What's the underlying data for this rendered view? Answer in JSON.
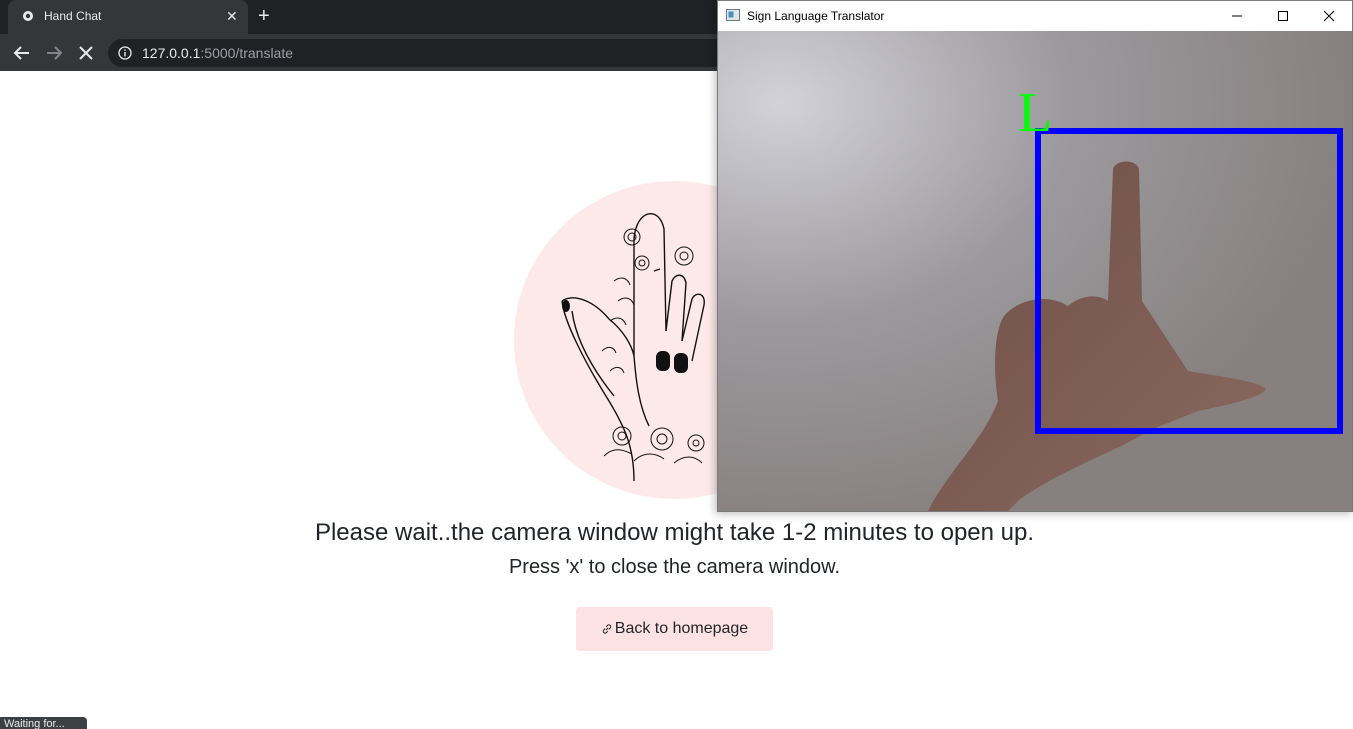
{
  "browser": {
    "tab_title": "Hand Chat",
    "tab_close": "✕",
    "new_tab": "+",
    "url_host": "127.0.0.1",
    "url_path": ":5000/translate"
  },
  "page": {
    "wait_message": "Please wait..the camera window might take 1-2 minutes to open up.",
    "close_hint": "Press 'x' to close the camera window.",
    "back_button_label": "Back to homepage",
    "status_text": "Waiting for..."
  },
  "camera_window": {
    "title": "Sign Language Translator",
    "predicted_letter": "L",
    "box_color": "#0000ff",
    "letter_color": "#00ff00"
  },
  "colors": {
    "hero_circle": "#fde9ea",
    "button_bg": "#fde2e4"
  }
}
